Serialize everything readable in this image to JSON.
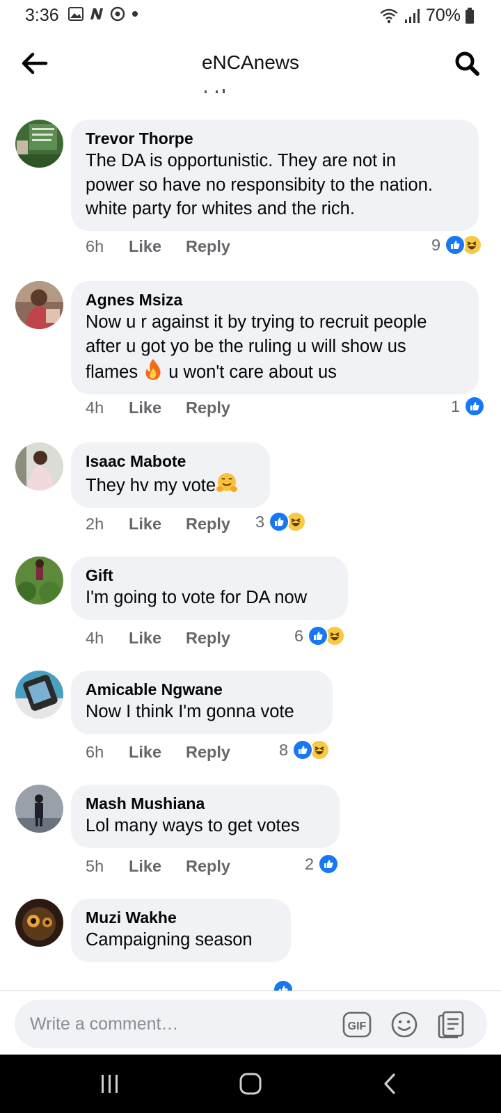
{
  "status_bar": {
    "time": "3:36",
    "battery": "70%"
  },
  "header": {
    "title": "eNCAnews"
  },
  "comments": [
    {
      "author": "Trevor Thorpe",
      "text": "The DA is opportunistic. They are not in\npower so have no responsibity to the nation.\nwhite party for whites and the rich.",
      "time": "6h",
      "like_label": "Like",
      "reply_label": "Reply",
      "reaction_count": "9",
      "reactions": [
        "like",
        "haha"
      ]
    },
    {
      "author": "Agnes Msiza",
      "text_before": "Now u r against it by trying to recruit people\nafter u got yo be the ruling u will show us\nflames ",
      "text_emoji": "fire",
      "text_after": " u won't care about us",
      "time": "4h",
      "like_label": "Like",
      "reply_label": "Reply",
      "reaction_count": "1",
      "reactions": [
        "like"
      ]
    },
    {
      "author": "Isaac Mabote",
      "text": "They hv my vote",
      "text_emoji": "hugging-face",
      "time": "2h",
      "like_label": "Like",
      "reply_label": "Reply",
      "reaction_count": "3",
      "reactions": [
        "like",
        "haha"
      ]
    },
    {
      "author": "Gift",
      "text": "I'm going to vote for DA now",
      "time": "4h",
      "like_label": "Like",
      "reply_label": "Reply",
      "reaction_count": "6",
      "reactions": [
        "like",
        "haha"
      ]
    },
    {
      "author": "Amicable Ngwane",
      "text": "Now I think I'm gonna vote",
      "time": "6h",
      "like_label": "Like",
      "reply_label": "Reply",
      "reaction_count": "8",
      "reactions": [
        "like",
        "haha"
      ]
    },
    {
      "author": "Mash Mushiana",
      "text": "Lol many ways to get votes",
      "time": "5h",
      "like_label": "Like",
      "reply_label": "Reply",
      "reaction_count": "2",
      "reactions": [
        "like"
      ]
    },
    {
      "author": "Muzi Wakhe",
      "text": "Campaigning season",
      "reactions": [
        "like"
      ]
    }
  ],
  "composer": {
    "placeholder": "Write a comment…",
    "gif_label": "GIF"
  },
  "colors": {
    "accent": "#1877f2",
    "bubble": "#f0f2f5",
    "meta": "#65676b",
    "haha": "#f7c945"
  },
  "icons": [
    "back-arrow-icon",
    "search-icon",
    "gif-icon",
    "emoji-icon",
    "sticker-icon",
    "recents-icon",
    "home-icon",
    "back-nav-icon"
  ]
}
